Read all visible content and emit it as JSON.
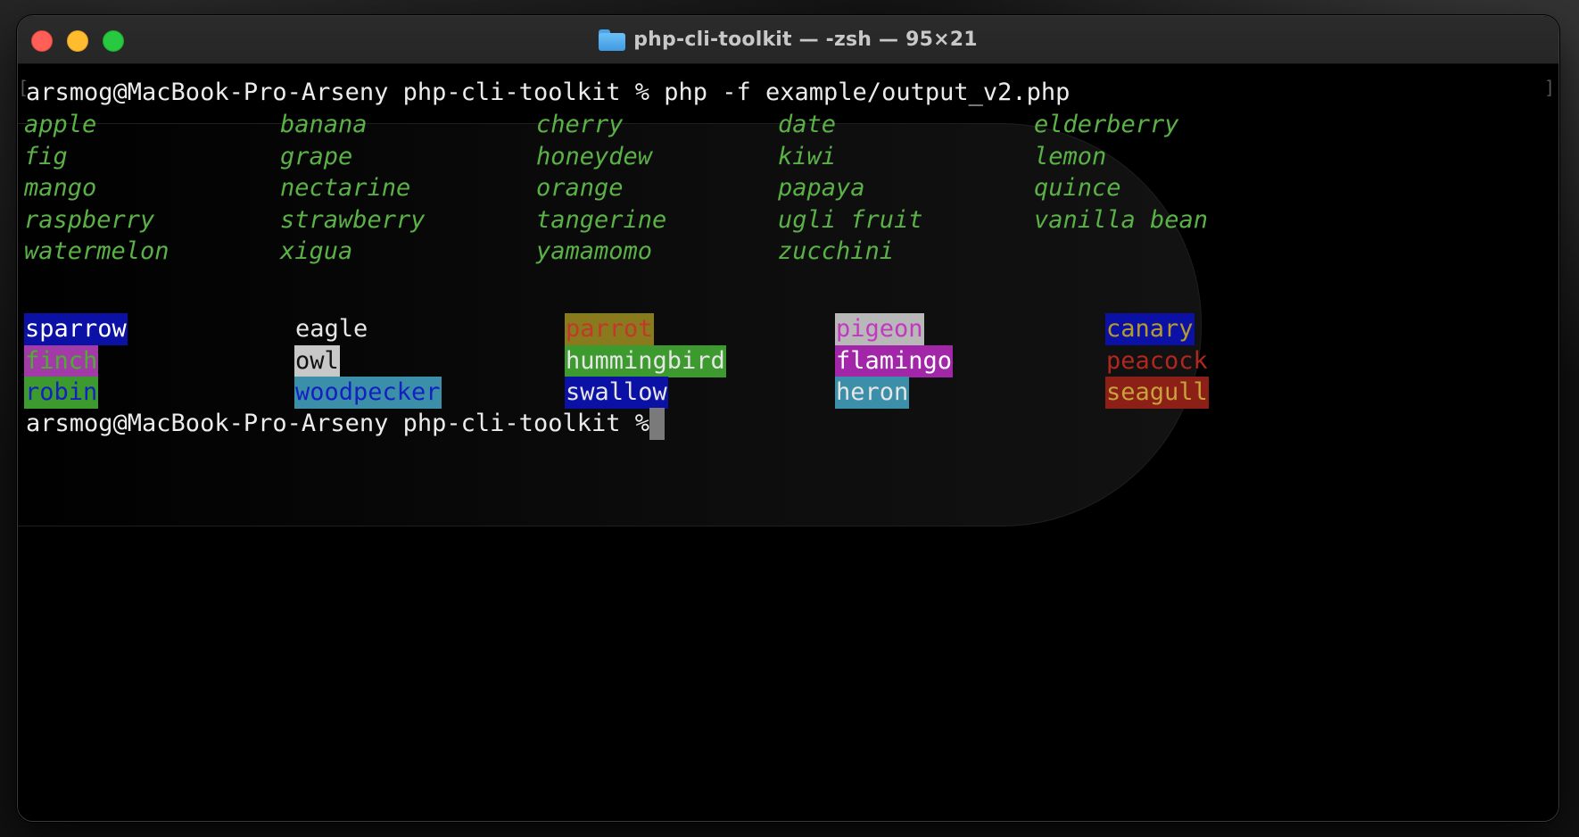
{
  "window": {
    "title": "php-cli-toolkit — -zsh — 95×21",
    "folder_icon": "folder-icon"
  },
  "terminal": {
    "command_line": "arsmog@MacBook-Pro-Arseny php-cli-toolkit % php -f example/output_v2.php",
    "fruits": [
      [
        "apple",
        "banana",
        "cherry",
        "date",
        "elderberry"
      ],
      [
        "fig",
        "grape",
        "honeydew",
        "kiwi",
        "lemon"
      ],
      [
        "mango",
        "nectarine",
        "orange",
        "papaya",
        "quince"
      ],
      [
        "raspberry",
        "strawberry",
        "tangerine",
        "ugli fruit",
        "vanilla bean"
      ],
      [
        "watermelon",
        "xigua",
        "yamamomo",
        "zucchini"
      ]
    ],
    "fruit_color": "#5ab146",
    "birds": [
      [
        {
          "text": "sparrow",
          "fg": "#ffffff",
          "bg": "#0c11a6"
        },
        {
          "text": "eagle",
          "fg": "#e6e6e6",
          "bg": ""
        },
        {
          "text": "parrot",
          "fg": "#c0392b",
          "bg": "#8a7a1e"
        },
        {
          "text": "pigeon",
          "fg": "#c338c0",
          "bg": "#b8b8b8"
        },
        {
          "text": "canary",
          "fg": "#b59b2a",
          "bg": "#0c11a6"
        }
      ],
      [
        {
          "text": "finch",
          "fg": "#4caf2f",
          "bg": "#a23aa8"
        },
        {
          "text": "owl",
          "fg": "#111111",
          "bg": "#c8c8c8"
        },
        {
          "text": "hummingbird",
          "fg": "#e6e6e6",
          "bg": "#3c9a2e"
        },
        {
          "text": "flamingo",
          "fg": "#ffffff",
          "bg": "#a126a8"
        },
        {
          "text": "peacock",
          "fg": "#b3261e",
          "bg": ""
        }
      ],
      [
        {
          "text": "robin",
          "fg": "#1520c0",
          "bg": "#3c9a2e"
        },
        {
          "text": "woodpecker",
          "fg": "#1520c0",
          "bg": "#3b8fa8"
        },
        {
          "text": "swallow",
          "fg": "#e6e6e6",
          "bg": "#0c11a6"
        },
        {
          "text": "heron",
          "fg": "#e6e6e6",
          "bg": "#3b8fa8"
        },
        {
          "text": "seagull",
          "fg": "#c8a23a",
          "bg": "#8c1f16"
        }
      ]
    ],
    "prompt": "arsmog@MacBook-Pro-Arseny php-cli-toolkit % "
  }
}
